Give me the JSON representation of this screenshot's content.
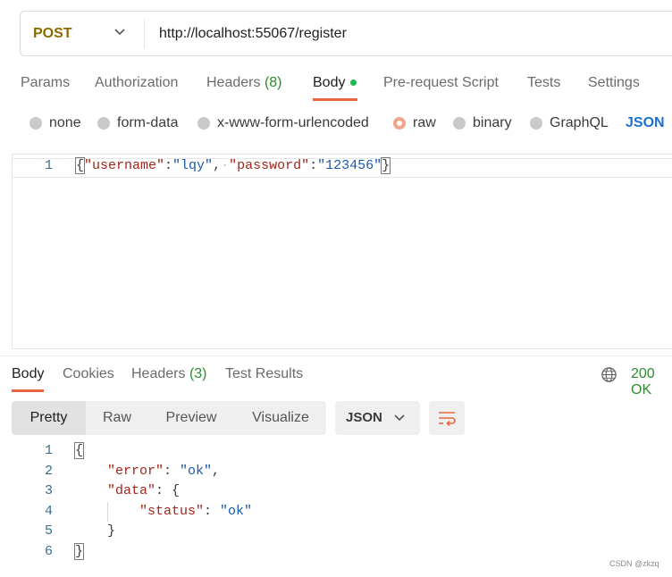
{
  "request": {
    "method": "POST",
    "url": "http://localhost:55067/register"
  },
  "request_tabs": {
    "params": "Params",
    "authorization": "Authorization",
    "headers": "Headers",
    "headers_count": "(8)",
    "body": "Body",
    "prerequest": "Pre-request Script",
    "tests": "Tests",
    "settings": "Settings"
  },
  "body_types": {
    "none": "none",
    "form_data": "form-data",
    "urlencoded": "x-www-form-urlencoded",
    "raw": "raw",
    "binary": "binary",
    "graphql": "GraphQL",
    "format": "JSON"
  },
  "request_body": {
    "line_number": "1",
    "open_brace": "{",
    "k1": "\"username\"",
    "colon": ":",
    "v1": "\"lqy\"",
    "comma": ",",
    "dot": "·",
    "k2": "\"password\"",
    "v2": "\"123456\"",
    "close_brace": "}"
  },
  "response_tabs": {
    "body": "Body",
    "cookies": "Cookies",
    "headers": "Headers",
    "headers_count": "(3)",
    "test_results": "Test Results"
  },
  "status": "200 OK",
  "view": {
    "pretty": "Pretty",
    "raw": "Raw",
    "preview": "Preview",
    "visualize": "Visualize",
    "format": "JSON"
  },
  "response_body": {
    "line_numbers": [
      "1",
      "2",
      "3",
      "4",
      "5",
      "6"
    ],
    "open_brace": "{",
    "error_key": "\"error\"",
    "error_val": "\"ok\"",
    "data_key": "\"data\"",
    "status_key": "\"status\"",
    "status_val": "\"ok\"",
    "colon": ": ",
    "comma": ",",
    "inner_open": "{",
    "inner_close": "}",
    "close_brace": "}"
  },
  "watermark": "CSDN @zkzq",
  "colors": {
    "accent": "#e8663f",
    "method": "#8a6a00",
    "status_ok": "#2e8b2e",
    "json_link": "#1f6fd1"
  }
}
